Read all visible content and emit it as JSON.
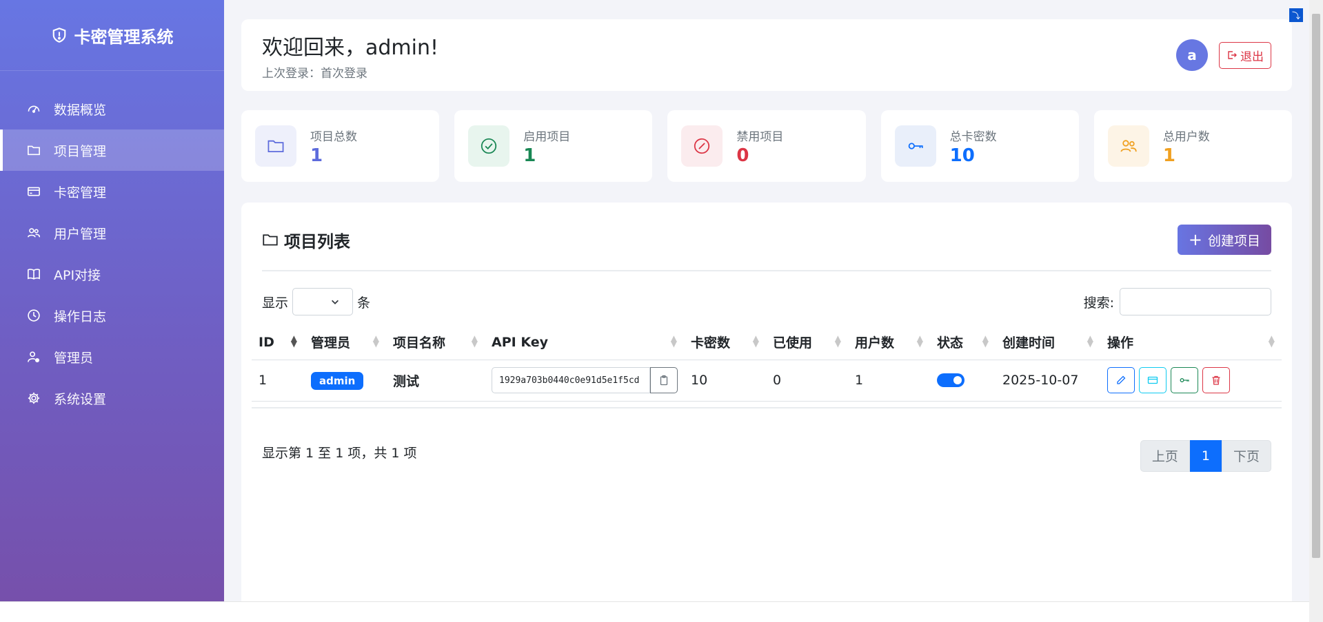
{
  "sidebar": {
    "brand": "卡密管理系统",
    "items": [
      {
        "label": "数据概览",
        "icon": "speedometer-icon"
      },
      {
        "label": "项目管理",
        "icon": "folder-icon"
      },
      {
        "label": "卡密管理",
        "icon": "card-icon"
      },
      {
        "label": "用户管理",
        "icon": "users-icon"
      },
      {
        "label": "API对接",
        "icon": "book-icon"
      },
      {
        "label": "操作日志",
        "icon": "clock-icon"
      },
      {
        "label": "管理员",
        "icon": "admin-icon"
      },
      {
        "label": "系统设置",
        "icon": "gear-icon"
      }
    ]
  },
  "header": {
    "welcome": "欢迎回来，admin!",
    "last_login": "上次登录：首次登录",
    "avatar": "a",
    "logout": "退出"
  },
  "stats": [
    {
      "label": "项目总数",
      "value": "1",
      "color": "#5d6bdc",
      "bg": "#eef0fb"
    },
    {
      "label": "启用项目",
      "value": "1",
      "color": "#198754",
      "bg": "#e8f5ee"
    },
    {
      "label": "禁用项目",
      "value": "0",
      "color": "#dc3545",
      "bg": "#fbecee"
    },
    {
      "label": "总卡密数",
      "value": "10",
      "color": "#0d6efd",
      "bg": "#e9effa"
    },
    {
      "label": "总用户数",
      "value": "1",
      "color": "#f0a020",
      "bg": "#fdf4e6"
    }
  ],
  "panel": {
    "title": "项目列表",
    "create": "创建项目",
    "show_prefix": "显示",
    "show_suffix": "条",
    "search_label": "搜索:",
    "footer_info": "显示第 1 至 1 项，共 1 项",
    "prev": "上页",
    "page": "1",
    "next": "下页"
  },
  "table": {
    "headers": [
      "ID",
      "管理员",
      "项目名称",
      "API Key",
      "卡密数",
      "已使用",
      "用户数",
      "状态",
      "创建时间",
      "操作"
    ],
    "row": {
      "id": "1",
      "admin": "admin",
      "name": "测试",
      "api_key": "1929a703b0440c0e91d5e1f5cd",
      "cards": "10",
      "used": "0",
      "users": "1",
      "created": "2025-10-07"
    }
  },
  "colors": {
    "primary": "#0d6efd",
    "danger": "#dc3545",
    "accent": "#6a74dd"
  }
}
